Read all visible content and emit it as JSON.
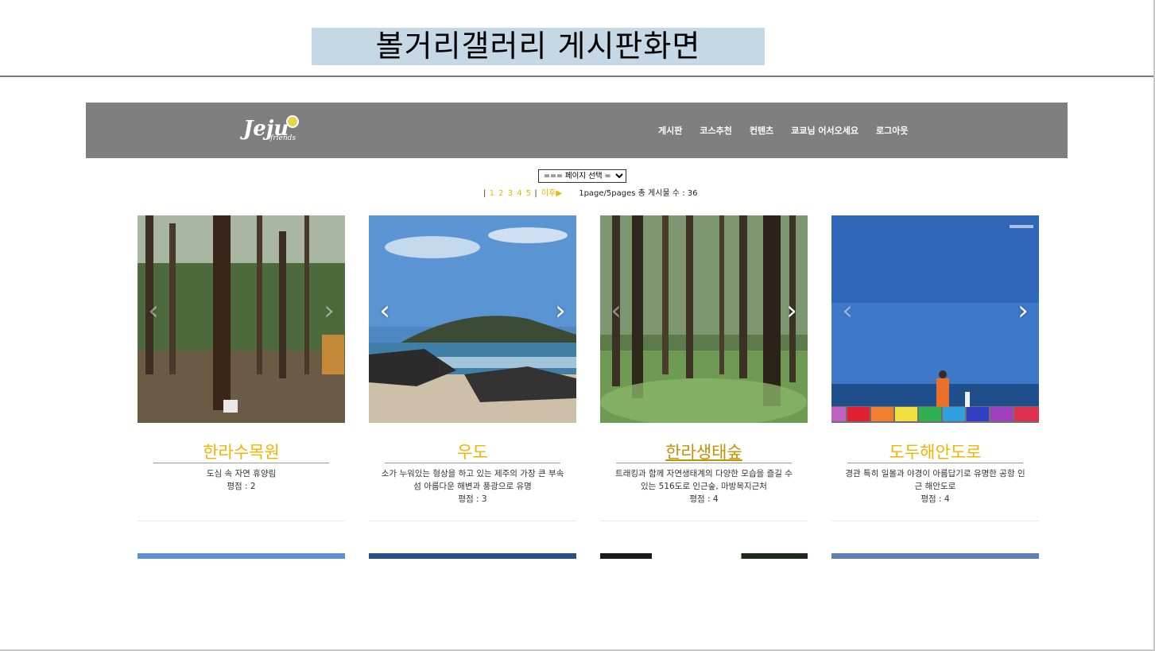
{
  "slide": {
    "title": "볼거리갤러리 게시판화면"
  },
  "navbar": {
    "logo": {
      "main": "Jeju",
      "sub": "friends"
    },
    "menu": [
      "게시판",
      "코스추천",
      "컨텐츠",
      "쿄쿄님 어서오세요",
      "로그아웃"
    ]
  },
  "page_select": {
    "selected": "=== 페이지 선택 ==="
  },
  "pager": {
    "pages": [
      "1",
      "2",
      "3",
      "4",
      "5"
    ],
    "next": "이후▶",
    "info": "1page/5pages 총 게시물 수 : 36"
  },
  "cards": [
    {
      "title": "한라수목원",
      "desc": "도심 속 자연 휴양림",
      "rating": "평점 : 2"
    },
    {
      "title": "우도",
      "desc": "소가 누워있는 형상을 하고 있는 제주의 가장 큰 부속섬 아름다운 해변과 풍광으로 유명",
      "rating": "평점 : 3"
    },
    {
      "title": "한라생태숲",
      "desc": "트래킹과 함께 자연생태계의 다양한 모습을 즐길 수 있는 516도로 인근숲, 마방목지근처",
      "rating": "평점 : 4"
    },
    {
      "title": "도두해안도로",
      "desc": "경관 특히 일몰과 야경이 아름답기로 유명한 공항 인근 해안도로",
      "rating": "평점 : 4"
    }
  ],
  "icons": {
    "prev": "chevron-left-icon",
    "next": "chevron-right-icon"
  },
  "colors": {
    "accent": "#f0b400",
    "navbar": "#7f7f7f",
    "title_box": "#c5d8e6"
  }
}
